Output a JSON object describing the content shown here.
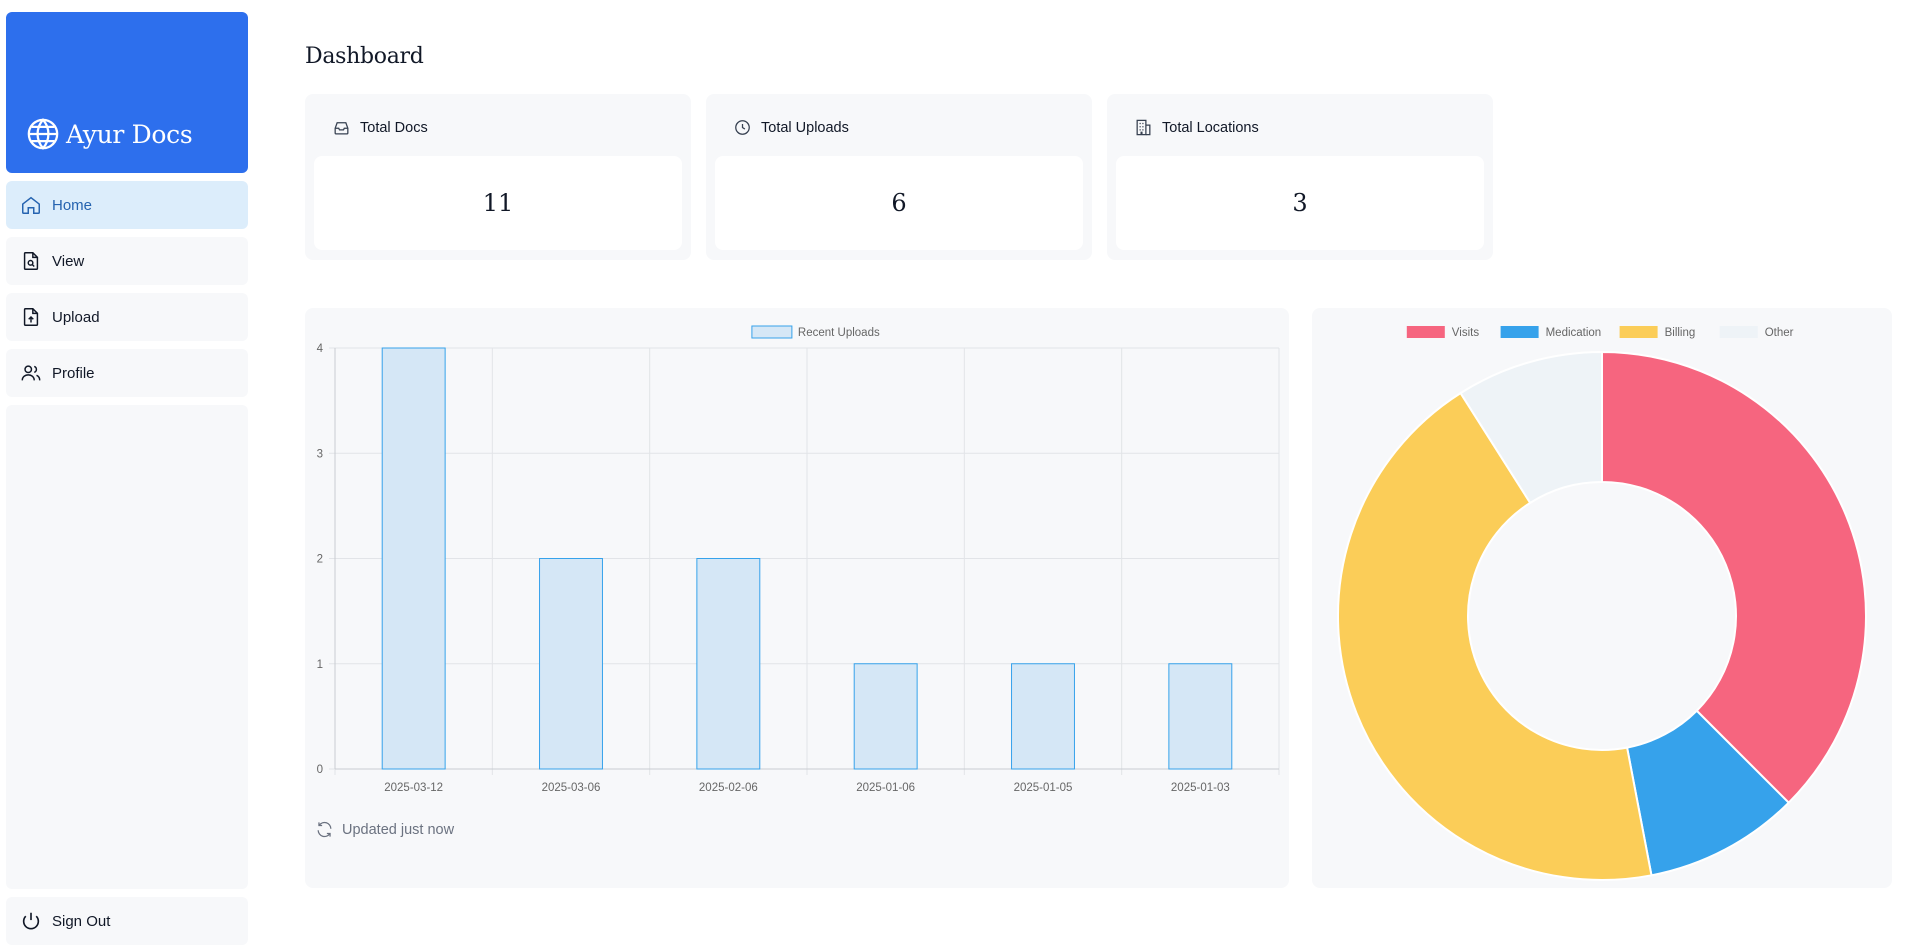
{
  "brand": {
    "name": "Ayur Docs",
    "icon": "globe-icon"
  },
  "nav": {
    "items": [
      {
        "label": "Home",
        "icon": "home-icon",
        "active": true
      },
      {
        "label": "View",
        "icon": "file-search-icon",
        "active": false
      },
      {
        "label": "Upload",
        "icon": "file-upload-icon",
        "active": false
      },
      {
        "label": "Profile",
        "icon": "users-icon",
        "active": false
      }
    ],
    "signout": {
      "label": "Sign Out",
      "icon": "power-icon"
    }
  },
  "page": {
    "title": "Dashboard"
  },
  "stats": [
    {
      "label": "Total Docs",
      "value": "11",
      "icon": "inbox-icon"
    },
    {
      "label": "Total Uploads",
      "value": "6",
      "icon": "clock-icon"
    },
    {
      "label": "Total Locations",
      "value": "3",
      "icon": "building-icon"
    }
  ],
  "status": {
    "updated_label": "Updated just now",
    "icon": "refresh-icon"
  },
  "colors": {
    "brand": "#2d6fed",
    "bar_fill": "#d5e7f6",
    "bar_stroke": "#36a2eb",
    "visits": "#f6657f",
    "medication": "#36a2eb",
    "billing": "#fbcd58",
    "other": "#eef3f7"
  },
  "chart_data": [
    {
      "type": "bar",
      "legend": [
        "Recent Uploads"
      ],
      "categories": [
        "2025-03-12",
        "2025-03-06",
        "2025-02-06",
        "2025-01-06",
        "2025-01-05",
        "2025-01-03"
      ],
      "series": [
        {
          "name": "Recent Uploads",
          "values": [
            4,
            2,
            2,
            1,
            1,
            1
          ]
        }
      ],
      "ylim": [
        0,
        4
      ],
      "yticks": [
        0,
        1,
        2,
        3,
        4
      ],
      "grid": true,
      "legend_position": "top-center"
    },
    {
      "type": "pie",
      "variant": "doughnut",
      "labels": [
        "Visits",
        "Medication",
        "Billing",
        "Other"
      ],
      "values": [
        37.5,
        9.5,
        44,
        9
      ],
      "legend_position": "top-center"
    }
  ]
}
